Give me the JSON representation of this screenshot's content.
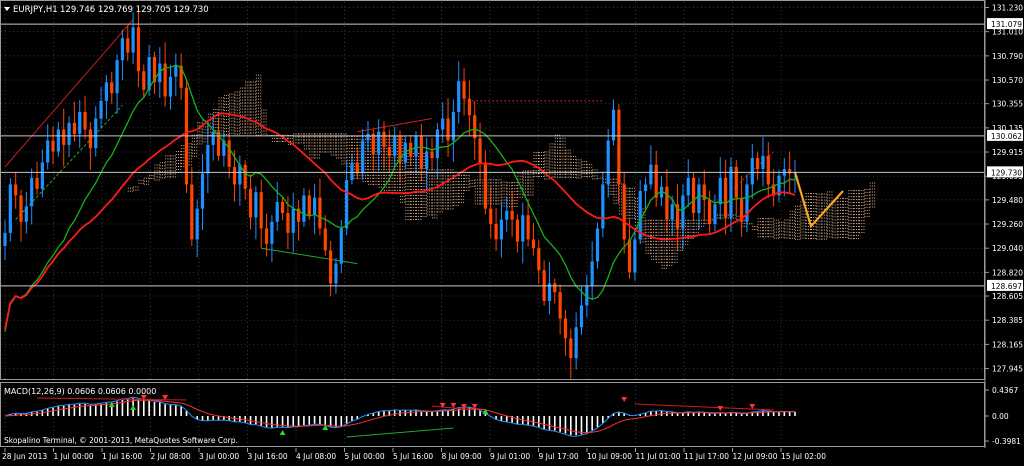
{
  "header": {
    "symbol": "EURJPY,H1",
    "ohlc": "129.746 129.769 129.705 129.730"
  },
  "macd": {
    "label": "MACD(12,26,9) 0.0606 0.0606 0.0000",
    "axis_labels": [
      "0.4367",
      "0.00",
      "-0.3981"
    ]
  },
  "footer": {
    "copyright": "Skopalino Terminal, © 2001-2013, MetaQuotes Software Corp."
  },
  "colors": {
    "background": "#000000",
    "grid": "#3a3a3a",
    "bull": "#1e90ff",
    "bear": "#ff4500",
    "ma_red": "#ff1a1a",
    "ma_green": "#18b218",
    "cloud": "#e0b090",
    "forecast": "#f5a623",
    "macd_line": "#1e90ff",
    "signal_line": "#ff3030",
    "hist": "#ffffff"
  },
  "chart_data": {
    "type": "candlestick",
    "price_axis": {
      "range": [
        127.85,
        131.28
      ],
      "ticks": [
        "131.230",
        "131.010",
        "130.790",
        "130.570",
        "130.355",
        "130.135",
        "129.915",
        "129.695",
        "129.480",
        "129.260",
        "129.040",
        "128.820",
        "128.605",
        "128.385",
        "128.165",
        "127.945"
      ]
    },
    "price_labels": [
      {
        "text": "131.079",
        "value": 131.079
      },
      {
        "text": "130.062",
        "value": 130.062
      },
      {
        "text": "129.730",
        "value": 129.73
      },
      {
        "text": "128.697",
        "value": 128.697
      }
    ],
    "time_labels": [
      "28 Jun 2013",
      "1 Jul 00:00",
      "1 Jul 16:00",
      "2 Jul 08:00",
      "3 Jul 00:00",
      "3 Jul 16:00",
      "4 Jul 08:00",
      "5 Jul 00:00",
      "5 Jul 16:00",
      "8 Jul 09:00",
      "9 Jul 01:00",
      "9 Jul 17:00",
      "10 Jul 09:00",
      "11 Jul 01:00",
      "11 Jul 17:00",
      "12 Jul 09:00",
      "15 Jul 02:00"
    ],
    "closes": [
      129.18,
      129.62,
      129.52,
      129.28,
      129.42,
      129.68,
      129.58,
      129.82,
      130.02,
      129.92,
      130.12,
      129.98,
      130.18,
      130.08,
      130.28,
      130.12,
      129.95,
      130.22,
      130.38,
      130.55,
      130.45,
      130.75,
      130.95,
      130.82,
      131.05,
      130.65,
      130.48,
      130.78,
      130.55,
      130.72,
      130.42,
      130.6,
      130.7,
      130.5,
      129.62,
      129.12,
      129.4,
      129.72,
      129.98,
      130.1,
      129.88,
      130.02,
      129.78,
      129.62,
      129.8,
      129.58,
      129.32,
      129.55,
      129.22,
      129.08,
      129.28,
      129.46,
      129.36,
      129.18,
      129.4,
      129.28,
      129.52,
      129.34,
      129.5,
      129.22,
      129.02,
      128.72,
      128.9,
      129.22,
      129.66,
      129.82,
      129.72,
      130.02,
      130.08,
      129.9,
      130.1,
      129.96,
      129.88,
      130.06,
      129.82,
      130.0,
      129.88,
      130.06,
      129.76,
      129.92,
      129.86,
      130.12,
      130.22,
      130.02,
      130.28,
      130.56,
      130.4,
      130.25,
      130.04,
      129.82,
      129.4,
      129.26,
      129.12,
      129.3,
      129.38,
      129.3,
      129.1,
      129.34,
      129.12,
      129.04,
      128.84,
      128.56,
      128.72,
      128.64,
      128.4,
      128.22,
      128.04,
      128.32,
      128.52,
      128.7,
      128.92,
      129.22,
      129.62,
      130.02,
      130.3,
      129.62,
      129.12,
      128.82,
      129.12,
      129.56,
      129.62,
      129.8,
      129.5,
      129.6,
      129.3,
      129.44,
      129.22,
      129.52,
      129.68,
      129.36,
      129.62,
      129.48,
      129.26,
      129.44,
      129.68,
      129.32,
      129.78,
      129.5,
      129.28,
      129.62,
      129.86,
      129.76,
      129.88,
      129.62,
      129.52,
      129.7,
      129.76,
      129.72,
      129.73
    ],
    "forecast": [
      129.73,
      129.24,
      129.56
    ]
  }
}
